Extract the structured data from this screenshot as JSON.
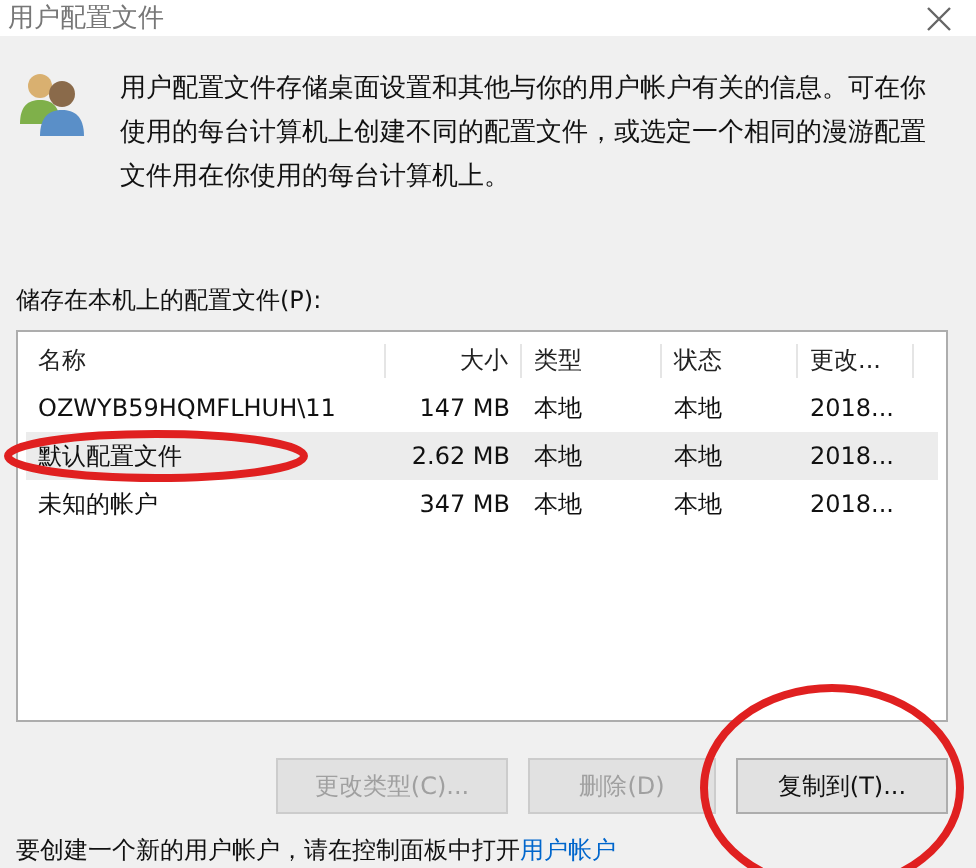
{
  "window": {
    "title": "用户配置文件"
  },
  "description": "用户配置文件存储桌面设置和其他与你的用户帐户有关的信息。可在你使用的每台计算机上创建不同的配置文件，或选定一个相同的漫游配置文件用在你使用的每台计算机上。",
  "list_label": "储存在本机上的配置文件(P):",
  "table": {
    "columns": [
      "名称",
      "大小",
      "类型",
      "状态",
      "更改..."
    ],
    "rows": [
      {
        "cells": [
          "OZWYB59HQMFLHUH\\11",
          "147 MB",
          "本地",
          "本地",
          "2018..."
        ],
        "selected": false
      },
      {
        "cells": [
          "默认配置文件",
          "2.62 MB",
          "本地",
          "本地",
          "2018..."
        ],
        "selected": true
      },
      {
        "cells": [
          "未知的帐户",
          "347 MB",
          "本地",
          "本地",
          "2018..."
        ],
        "selected": false
      }
    ]
  },
  "buttons": [
    {
      "label": "更改类型(C)...",
      "disabled": true
    },
    {
      "label": "删除(D)",
      "disabled": true
    },
    {
      "label": "复制到(T)...",
      "disabled": false
    }
  ],
  "footer": {
    "text": "要创建一个新的用户帐户，请在控制面板中打开",
    "link": "用户帐户"
  }
}
